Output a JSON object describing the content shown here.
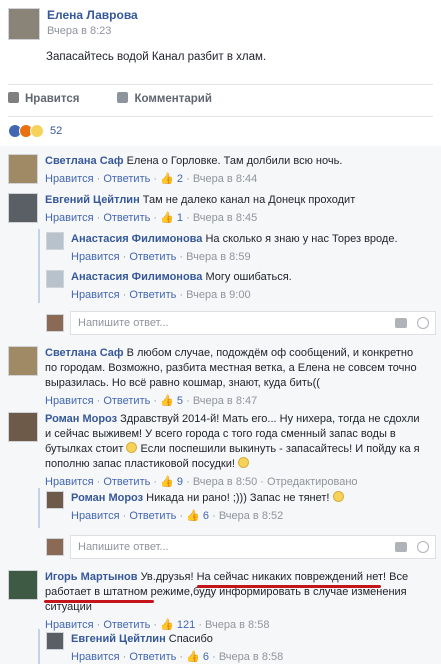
{
  "post": {
    "author": "Елена Лаврова",
    "time": "Вчера в 8:23",
    "text": "Запасайтесь водой Канал разбит в хлам.",
    "like_label": "Нравится",
    "comment_label": "Комментарий",
    "reaction_count": "52"
  },
  "labels": {
    "like": "Нравится",
    "reply": "Ответить",
    "edited": "Отредактировано",
    "reply_placeholder": "Напишите ответ..."
  },
  "comments": [
    {
      "name": "Светлана Саф",
      "text": "Елена о Горловке. Там долбили всю ночь.",
      "likes": "2",
      "time": "Вчера в 8:44"
    },
    {
      "name": "Евгений Цейтлин",
      "text": "Там не далеко канал на Донецк проходит",
      "likes": "1",
      "time": "Вчера в 8:45"
    },
    {
      "name": "Анастасия Филимонова",
      "text": "На сколько я знаю у нас Торез вроде.",
      "time": "Вчера в 8:59"
    },
    {
      "name": "Анастасия Филимонова",
      "text": "Могу ошибаться.",
      "time": "Вчера в 9:00"
    },
    {
      "name": "Светлана Саф",
      "text": "В любом случае, подождём оф сообщений, и конкретно по городам. Возможно, разбита местная ветка, а Елена не совсем точно выразилась. Но всё равно кошмар, знают, куда бить((",
      "likes": "5",
      "time": "Вчера в 8:47"
    },
    {
      "name": "Роман Мороз",
      "text": "Здравствуй 2014-й! Мать его... Ну нихера, тогда не сдохли и сейчас выживем! У всего города с того года сменный запас воды в бутылках стоит",
      "text2": "Если поспешили выкинуть - запасайтесь! И пойду ка я пополню запас пластиковой посудки!",
      "likes": "9",
      "time": "Вчера в 8:50"
    },
    {
      "name": "Роман Мороз",
      "text": "Никада ни рано! ;))) Запас не тянет!",
      "likes": "6",
      "time": "Вчера в 8:52"
    },
    {
      "name": "Игорь Мартынов",
      "text_a": "Ув.друзья! ",
      "text_b": "На сейчас никаких повреждений нет",
      "text_c": "! Все ",
      "text_d": "работает в штатном режиме",
      "text_e": ",буду информировать в случае изменения ситуации",
      "likes": "121",
      "time": "Вчера в 8:58"
    },
    {
      "name": "Евгений Цейтлин",
      "text": "Спасибо",
      "likes": "6",
      "time": "Вчера в 8:58"
    }
  ]
}
